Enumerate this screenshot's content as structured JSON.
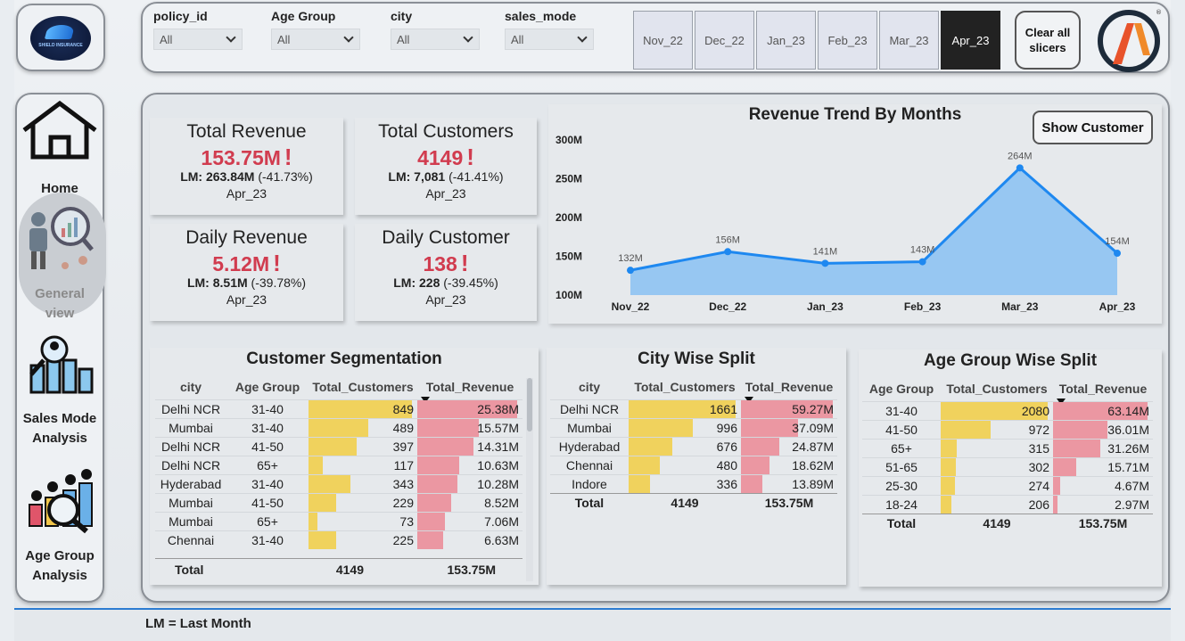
{
  "brand": {
    "logo_text": "SHIELD INSURANCE"
  },
  "filters": [
    {
      "label": "policy_id",
      "value": "All"
    },
    {
      "label": "Age Group",
      "value": "All"
    },
    {
      "label": "city",
      "value": "All"
    },
    {
      "label": "sales_mode",
      "value": "All"
    }
  ],
  "months": [
    "Nov_22",
    "Dec_22",
    "Jan_23",
    "Feb_23",
    "Mar_23",
    "Apr_23"
  ],
  "selected_month": "Apr_23",
  "clear_label": "Clear all slicers",
  "nav": {
    "home": "Home",
    "general": "General view",
    "sales": "Sales Mode Analysis",
    "age": "Age Group Analysis"
  },
  "kpis": {
    "total_revenue": {
      "title": "Total Revenue",
      "value": "153.75M",
      "lm_value": "LM: 263.84M",
      "lm_change": "(-41.73%)",
      "period": "Apr_23"
    },
    "total_customers": {
      "title": "Total Customers",
      "value": "4149",
      "lm_value": "LM: 7,081",
      "lm_change": "(-41.41%)",
      "period": "Apr_23"
    },
    "daily_revenue": {
      "title": "Daily Revenue",
      "value": "5.12M",
      "lm_value": "LM: 8.51M",
      "lm_change": "(-39.78%)",
      "period": "Apr_23"
    },
    "daily_customer": {
      "title": "Daily Customer",
      "value": "138",
      "lm_value": "LM: 228",
      "lm_change": "(-39.45%)",
      "period": "Apr_23"
    }
  },
  "warning_mark": "!",
  "show_customer_label": "Show Customer",
  "chart_data": {
    "type": "area",
    "title": "Revenue Trend By Months",
    "categories": [
      "Nov_22",
      "Dec_22",
      "Jan_23",
      "Feb_23",
      "Mar_23",
      "Apr_23"
    ],
    "values": [
      132,
      156,
      141,
      143,
      264,
      154
    ],
    "data_labels": [
      "132M",
      "156M",
      "141M",
      "143M",
      "264M",
      "154M"
    ],
    "y_ticks": [
      "100M",
      "150M",
      "200M",
      "250M",
      "300M"
    ],
    "ylim": [
      100,
      300
    ],
    "color": "#1e88f0"
  },
  "segmentation": {
    "title": "Customer Segmentation",
    "headers": [
      "city",
      "Age Group",
      "Total_Customers",
      "Total_Revenue"
    ],
    "rows": [
      {
        "city": "Delhi NCR",
        "age": "31-40",
        "customers": "849",
        "revenue": "25.38M",
        "c": 849,
        "r": 25.38
      },
      {
        "city": "Mumbai",
        "age": "31-40",
        "customers": "489",
        "revenue": "15.57M",
        "c": 489,
        "r": 15.57
      },
      {
        "city": "Delhi NCR",
        "age": "41-50",
        "customers": "397",
        "revenue": "14.31M",
        "c": 397,
        "r": 14.31
      },
      {
        "city": "Delhi NCR",
        "age": "65+",
        "customers": "117",
        "revenue": "10.63M",
        "c": 117,
        "r": 10.63
      },
      {
        "city": "Hyderabad",
        "age": "31-40",
        "customers": "343",
        "revenue": "10.28M",
        "c": 343,
        "r": 10.28
      },
      {
        "city": "Mumbai",
        "age": "41-50",
        "customers": "229",
        "revenue": "8.52M",
        "c": 229,
        "r": 8.52
      },
      {
        "city": "Mumbai",
        "age": "65+",
        "customers": "73",
        "revenue": "7.06M",
        "c": 73,
        "r": 7.06
      },
      {
        "city": "Chennai",
        "age": "31-40",
        "customers": "225",
        "revenue": "6.63M",
        "c": 225,
        "r": 6.63
      }
    ],
    "total": {
      "label": "Total",
      "customers": "4149",
      "revenue": "153.75M"
    }
  },
  "city_split": {
    "title": "City Wise Split",
    "headers": [
      "city",
      "Total_Customers",
      "Total_Revenue"
    ],
    "rows": [
      {
        "city": "Delhi NCR",
        "customers": "1661",
        "revenue": "59.27M",
        "c": 1661,
        "r": 59.27
      },
      {
        "city": "Mumbai",
        "customers": "996",
        "revenue": "37.09M",
        "c": 996,
        "r": 37.09
      },
      {
        "city": "Hyderabad",
        "customers": "676",
        "revenue": "24.87M",
        "c": 676,
        "r": 24.87
      },
      {
        "city": "Chennai",
        "customers": "480",
        "revenue": "18.62M",
        "c": 480,
        "r": 18.62
      },
      {
        "city": "Indore",
        "customers": "336",
        "revenue": "13.89M",
        "c": 336,
        "r": 13.89
      }
    ],
    "total": {
      "label": "Total",
      "customers": "4149",
      "revenue": "153.75M"
    }
  },
  "age_split": {
    "title": "Age Group Wise Split",
    "headers": [
      "Age Group",
      "Total_Customers",
      "Total_Revenue"
    ],
    "rows": [
      {
        "age": "31-40",
        "customers": "2080",
        "revenue": "63.14M",
        "c": 2080,
        "r": 63.14
      },
      {
        "age": "41-50",
        "customers": "972",
        "revenue": "36.01M",
        "c": 972,
        "r": 36.01
      },
      {
        "age": "65+",
        "customers": "315",
        "revenue": "31.26M",
        "c": 315,
        "r": 31.26
      },
      {
        "age": "51-65",
        "customers": "302",
        "revenue": "15.71M",
        "c": 302,
        "r": 15.71
      },
      {
        "age": "25-30",
        "customers": "274",
        "revenue": "4.67M",
        "c": 274,
        "r": 4.67
      },
      {
        "age": "18-24",
        "customers": "206",
        "revenue": "2.97M",
        "c": 206,
        "r": 2.97
      }
    ],
    "total": {
      "label": "Total",
      "customers": "4149",
      "revenue": "153.75M"
    }
  },
  "footer": "LM = Last Month"
}
